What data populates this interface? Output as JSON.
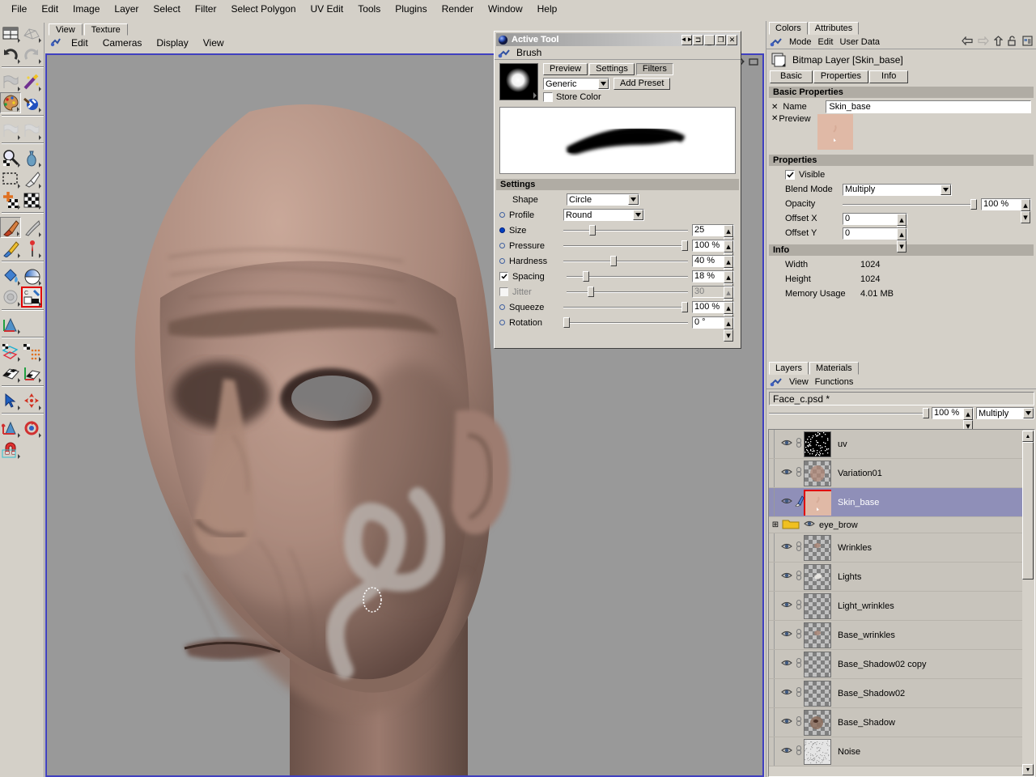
{
  "menubar": {
    "items": [
      "File",
      "Edit",
      "Image",
      "Layer",
      "Select",
      "Filter",
      "Select Polygon",
      "UV Edit",
      "Tools",
      "Plugins",
      "Render",
      "Window",
      "Help"
    ]
  },
  "viewport": {
    "tabs": [
      {
        "label": "View",
        "active": true
      },
      {
        "label": "Texture",
        "active": false
      }
    ],
    "menu": [
      "Edit",
      "Cameras",
      "Display",
      "View"
    ],
    "background_color": "#999999",
    "border_color": "#4040c0",
    "content_description": "3D shaded head model being texture painted, light gray S-shaped brush stroke on left cheek, round brush cursor outline below it",
    "icons": [
      "axis-icon",
      "frame-icon"
    ]
  },
  "toolbar": {
    "groups": [
      {
        "icons": [
          "grid-view-icon",
          "mesh-wire-icon"
        ]
      },
      {
        "icons": [
          "undo-icon",
          "redo-icon"
        ]
      },
      {
        "icons": [
          "flag-gray-icon",
          "magic-wand-icon"
        ]
      },
      {
        "icons": [
          "palette-icon",
          "paint-ball-icon"
        ],
        "selected": 0
      },
      {
        "icons": [
          "flag-dim-a-icon",
          "flag-dim-b-icon"
        ]
      },
      {
        "icons": [
          "magnify-icon",
          "vase-icon"
        ]
      },
      {
        "icons": [
          "marquee-select-icon",
          "brush-white-icon"
        ]
      },
      {
        "icons": [
          "move-checker-icon",
          "checker-box-icon"
        ]
      },
      {
        "icons": [
          "paint-brush-icon",
          "smudge-icon"
        ],
        "selected": 0
      },
      {
        "icons": [
          "eyedropper-icon",
          "pin-red-icon"
        ]
      },
      {
        "icons": [
          "fill-bucket-icon",
          "gradient-icon"
        ]
      },
      {
        "icons": [
          "ring-gray-icon",
          "texture-layer-icon"
        ],
        "redselected": 1
      },
      {
        "icons": [
          "axis-gizmo-icon"
        ]
      },
      {
        "icons": [
          "uv-edge-icon",
          "uv-points-icon"
        ]
      },
      {
        "icons": [
          "uv-plane-icon",
          "uv-axis-icon"
        ]
      },
      {
        "icons": [
          "cursor-arrow-icon",
          "move-star-icon"
        ]
      },
      {
        "icons": [
          "scale-icon",
          "rotate-icon"
        ]
      },
      {
        "icons": [
          "magnet-icon"
        ]
      }
    ]
  },
  "active_tool_dialog": {
    "title": "Active Tool",
    "title_icon": "sphere-blue-icon",
    "subtitle": "Brush",
    "subtitle_icon": "brush-blue-icon",
    "titlebar_buttons": [
      "dock-icon",
      "undock-icon",
      "minimize-icon",
      "maximize-icon",
      "close-icon"
    ],
    "tabs": [
      {
        "label": "Preview",
        "active": false
      },
      {
        "label": "Settings",
        "active": false
      },
      {
        "label": "Filters",
        "active": true
      }
    ],
    "preset_select": "Generic",
    "add_preset_label": "Add Preset",
    "store_color": {
      "label": "Store Color",
      "checked": false
    },
    "brush_thumb_description": "soft white round dab on black",
    "stroke_preview_description": "black tapered S-curve brush stroke on white",
    "settings_header": "Settings",
    "settings": [
      {
        "name": "Shape",
        "type": "combo",
        "value": "Circle",
        "marker": "none",
        "enabled": true
      },
      {
        "name": "Profile",
        "type": "combo",
        "value": "Round",
        "marker": "ring",
        "enabled": true
      },
      {
        "name": "Size",
        "type": "slider",
        "value": "25",
        "percent": 22,
        "marker": "dot",
        "enabled": true
      },
      {
        "name": "Pressure",
        "type": "slider",
        "value": "100 %",
        "percent": 100,
        "marker": "ring",
        "enabled": true
      },
      {
        "name": "Hardness",
        "type": "slider",
        "value": "40 %",
        "percent": 40,
        "marker": "ring",
        "enabled": true
      },
      {
        "name": "Spacing",
        "type": "slider",
        "value": "18 %",
        "percent": 14,
        "marker": "check",
        "checked": true,
        "enabled": true
      },
      {
        "name": "Jitter",
        "type": "slider",
        "value": "30",
        "percent": 18,
        "marker": "check",
        "checked": false,
        "enabled": false
      },
      {
        "name": "Squeeze",
        "type": "slider",
        "value": "100 %",
        "percent": 100,
        "marker": "ring",
        "enabled": true
      },
      {
        "name": "Rotation",
        "type": "slider",
        "value": "0 °",
        "percent": 0,
        "marker": "ring",
        "enabled": true
      }
    ]
  },
  "attributes_panel": {
    "tabs": [
      {
        "label": "Colors",
        "active": false
      },
      {
        "label": "Attributes",
        "active": true
      }
    ],
    "toolbar": {
      "icon": "brush-blue-icon",
      "menus": [
        "Mode",
        "Edit",
        "User Data"
      ],
      "icons": [
        "back-arrow-icon",
        "forward-arrow-icon",
        "up-arrow-icon",
        "unlock-icon",
        "layout-icon"
      ]
    },
    "object_title": "Bitmap Layer [Skin_base]",
    "object_icon": "bitmap-layer-icon",
    "subtabs": [
      {
        "label": "Basic",
        "active": false
      },
      {
        "label": "Properties",
        "active": false
      },
      {
        "label": "Info",
        "active": false
      }
    ],
    "basic_header": "Basic Properties",
    "name_label": "Name",
    "name_value": "Skin_base",
    "preview_label": "Preview",
    "preview_color": "#e0b9a6",
    "properties_header": "Properties",
    "visible_label": "Visible",
    "visible_checked": true,
    "blend_mode_label": "Blend Mode",
    "blend_mode_value": "Multiply",
    "opacity_label": "Opacity",
    "opacity_value": "100 %",
    "opacity_percent": 100,
    "offset_x_label": "Offset X",
    "offset_x_value": "0",
    "offset_y_label": "Offset Y",
    "offset_y_value": "0",
    "info_header": "Info",
    "info_rows": [
      {
        "label": "Width",
        "value": "1024"
      },
      {
        "label": "Height",
        "value": "1024"
      },
      {
        "label": "Memory Usage",
        "value": "4.01 MB"
      }
    ]
  },
  "layers_panel": {
    "tabs": [
      {
        "label": "Layers",
        "active": true
      },
      {
        "label": "Materials",
        "active": false
      }
    ],
    "toolbar": {
      "icon": "brush-blue-icon",
      "menus": [
        "View",
        "Functions"
      ]
    },
    "document_name": "Face_c.psd *",
    "opacity_value": "100 %",
    "opacity_percent": 100,
    "blend_mode": "Multiply",
    "layers": [
      {
        "name": "uv",
        "visible": true,
        "linked": true,
        "thumb": "noise-black",
        "selected": false,
        "type": "layer"
      },
      {
        "name": "Variation01",
        "visible": true,
        "linked": true,
        "thumb": "checker-skin",
        "selected": false,
        "type": "layer"
      },
      {
        "name": "Skin_base",
        "visible": true,
        "linked": false,
        "brush": true,
        "thumb": "skin",
        "selected": true,
        "type": "layer"
      },
      {
        "name": "eye_brow",
        "visible": true,
        "type": "folder",
        "expanded": false
      },
      {
        "name": "Wrinkles",
        "visible": true,
        "linked": true,
        "thumb": "checker-faint",
        "selected": false,
        "type": "layer"
      },
      {
        "name": "Lights",
        "visible": true,
        "linked": true,
        "thumb": "checker-light",
        "selected": false,
        "type": "layer"
      },
      {
        "name": "Light_wrinkles",
        "visible": true,
        "linked": true,
        "thumb": "checker-empty",
        "selected": false,
        "type": "layer"
      },
      {
        "name": "Base_wrinkles",
        "visible": true,
        "linked": true,
        "thumb": "checker-faint",
        "selected": false,
        "type": "layer"
      },
      {
        "name": "Base_Shadow02 copy",
        "visible": true,
        "linked": true,
        "thumb": "checker-empty",
        "selected": false,
        "type": "layer"
      },
      {
        "name": "Base_Shadow02",
        "visible": true,
        "linked": true,
        "thumb": "checker-empty",
        "selected": false,
        "type": "layer"
      },
      {
        "name": "Base_Shadow",
        "visible": true,
        "linked": true,
        "thumb": "checker-shadow",
        "selected": false,
        "type": "layer"
      },
      {
        "name": "Noise",
        "visible": true,
        "linked": true,
        "thumb": "noise-white",
        "selected": false,
        "type": "layer"
      }
    ]
  },
  "colors": {
    "panel_bg": "#d4d0c8",
    "section_header": "#b0aca4",
    "selection": "#8f8fb8",
    "viewport_bg": "#999999",
    "accent_red": "#e00000"
  }
}
